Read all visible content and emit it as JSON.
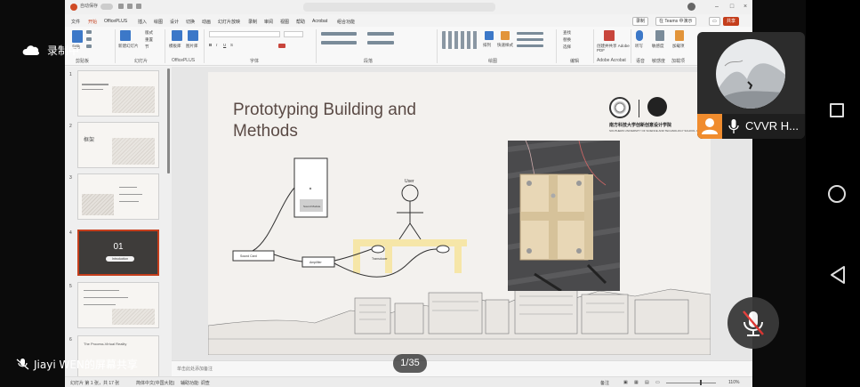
{
  "meeting": {
    "recording_label": "录制中",
    "page_counter": "1/35",
    "share_label": "Jiayi WEN的屏幕共享",
    "participant": {
      "name": "CVVR H..."
    }
  },
  "app": {
    "autosave": "自动保存",
    "menus": [
      "文件",
      "开始",
      "OfficePLUS",
      "插入",
      "绘图",
      "设计",
      "切换",
      "动画",
      "幻灯片放映",
      "录制",
      "审阅",
      "视图",
      "帮助",
      "Acrobat",
      "组合功能"
    ],
    "active_menu": "开始",
    "record_button": "录制",
    "teams_button": "在 Teams 中演示",
    "share_button": "共享",
    "ribbon_groups": [
      "剪贴板",
      "幻灯片",
      "OfficePLUS",
      "字体",
      "段落",
      "绘图",
      "编辑",
      "Adobe Acrobat",
      "语音",
      "敏感度",
      "加载项"
    ],
    "ribbon_labels": {
      "paste": "粘贴",
      "new_slide": "新建幻灯片",
      "reuse": "重用幻灯片",
      "layout": "版式",
      "reset": "重置",
      "section": "节",
      "templates": "模板库",
      "image_library": "图片库",
      "arrange": "排列",
      "quick_styles": "快速样式",
      "find": "查找",
      "replace": "替换",
      "select": "选择",
      "create_pdf": "创建并共享 Adobe PDF",
      "dictate": "听写",
      "sensitivity": "敏感度",
      "addins": "加载项"
    }
  },
  "thumbnails": [
    {
      "num": "1"
    },
    {
      "num": "2",
      "title": "框架"
    },
    {
      "num": "3"
    },
    {
      "num": "4",
      "big": "01",
      "pill": "Introduction"
    },
    {
      "num": "5"
    },
    {
      "num": "6",
      "title": "The Process-Virtual Reality"
    }
  ],
  "slide": {
    "title": "Prototyping Building and Methods",
    "logo_cn": "南方科技大学创新创意设计学院",
    "logo_en": "SOUTHERN UNIVERSITY OF SCIENCE AND TECHNOLOGY SCHOOL OF DESIGN",
    "logo_mark": "SD",
    "diagram": {
      "user": "User",
      "sound_mod": "Sound Module",
      "sound_card": "Sound Card",
      "amplifier": "Amplifier",
      "transducer": "Transducer"
    }
  },
  "notes": {
    "placeholder": "单击此处添加备注"
  },
  "status": {
    "slide_info": "幻灯片 第 1 张，共 17 张",
    "language": "简体中文(中国大陆)",
    "accessibility": "辅助功能: 调查",
    "notes": "备注",
    "zoom": "110%"
  }
}
